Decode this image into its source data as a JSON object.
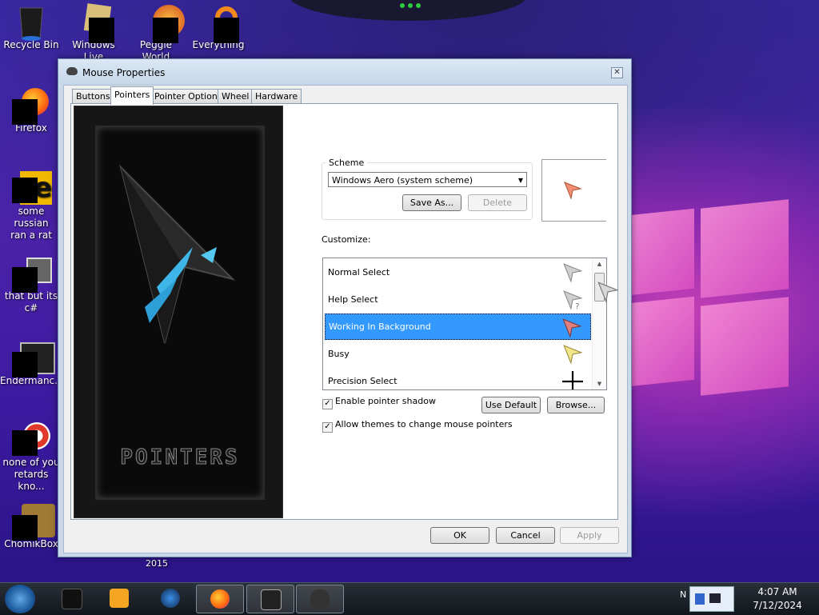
{
  "desktop": {
    "icons": [
      {
        "name": "desktop-icon-recycle-bin",
        "label": "Recycle Bin"
      },
      {
        "name": "desktop-icon-windows-live",
        "label": "Windows Live"
      },
      {
        "name": "desktop-icon-peggle-world",
        "label": "Peggle World"
      },
      {
        "name": "desktop-icon-everything",
        "label": "Everything"
      },
      {
        "name": "desktop-icon-firefox",
        "label": "Firefox"
      },
      {
        "name": "desktop-icon-russian-rat",
        "label": "some russian\nran a rat"
      },
      {
        "name": "desktop-icon-that-but-its",
        "label": "that but its c#"
      },
      {
        "name": "desktop-icon-endermanch",
        "label": "Endermanc..."
      },
      {
        "name": "desktop-icon-none-of-you",
        "label": "none of you\nretards kno..."
      },
      {
        "name": "desktop-icon-chomikbox",
        "label": "ChomikBox"
      }
    ],
    "stray_label": "2015"
  },
  "dialog": {
    "title": "Mouse Properties",
    "close_glyph": "✕",
    "tabs": [
      "Buttons",
      "Pointers",
      "Pointer Options",
      "Wheel",
      "Hardware"
    ],
    "active_tab": "Pointers",
    "art_text": "POINTERS",
    "scheme": {
      "legend": "Scheme",
      "selected": "Windows Aero (system scheme)",
      "save_as": "Save As...",
      "delete": "Delete"
    },
    "customize_label": "Customize:",
    "pointers": [
      {
        "label": "Normal Select",
        "icon": "arrow-cursor-icon",
        "color": "#cfcfcf"
      },
      {
        "label": "Help Select",
        "icon": "help-cursor-icon",
        "color": "#cfcfcf"
      },
      {
        "label": "Working In Background",
        "icon": "working-cursor-icon",
        "color": "#e28080",
        "selected": true
      },
      {
        "label": "Busy",
        "icon": "busy-cursor-icon",
        "color": "#f2e68a"
      },
      {
        "label": "Precision Select",
        "icon": "crosshair-cursor-icon",
        "color": "#000000"
      }
    ],
    "enable_shadow": {
      "label": "Enable pointer shadow",
      "checked": true
    },
    "allow_themes": {
      "label": "Allow themes to change mouse pointers",
      "checked": true
    },
    "use_default": "Use Default",
    "browse": "Browse...",
    "ok": "OK",
    "cancel": "Cancel",
    "apply": "Apply"
  },
  "taskbar": {
    "tray_text": "N",
    "time": "4:07 AM",
    "date": "7/12/2024"
  },
  "colors": {
    "selection": "#3399ff",
    "preview_cursor": "#f08f74"
  }
}
